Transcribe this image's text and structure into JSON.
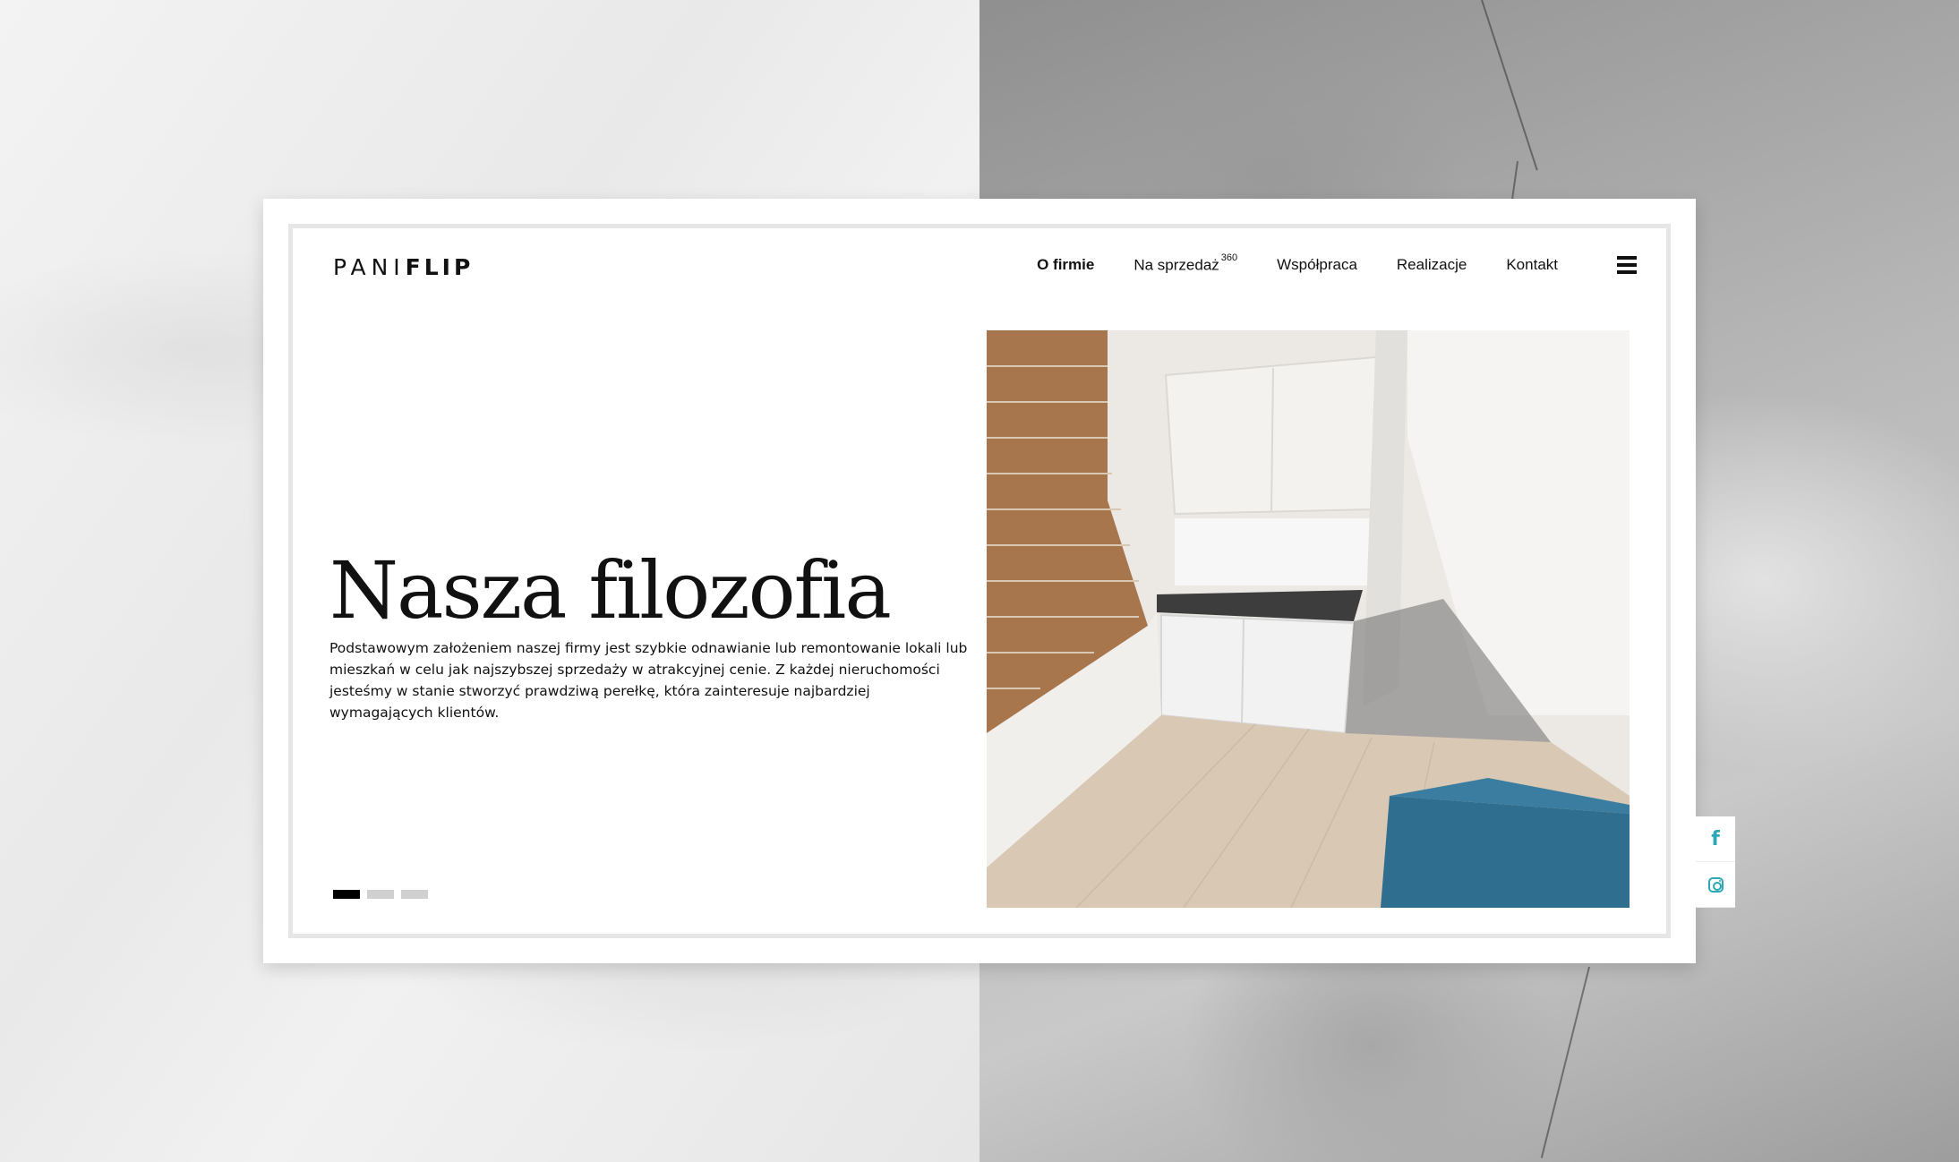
{
  "brand": {
    "logo_part1": "PANI",
    "logo_part2": "FLIP"
  },
  "nav": {
    "items": [
      {
        "label": "O firmie",
        "active": true
      },
      {
        "label": "Na sprzedaż",
        "sup": "360"
      },
      {
        "label": "Współpraca"
      },
      {
        "label": "Realizacje"
      },
      {
        "label": "Kontakt"
      }
    ],
    "menu_icon": "hamburger-icon"
  },
  "hero": {
    "title": "Nasza filozofia",
    "text": "Podstawowym założeniem naszej firmy jest szybkie odnawianie lub remontowanie lokali lub mieszkań w celu jak najszybszej sprzedaży w atrakcyjnej cenie. Z każdej nieruchomości jesteśmy w stanie stworzyć prawdziwą perełkę, która zainteresuje najbardziej wymagających klientów.",
    "slider": {
      "total": 3,
      "active_index": 0
    }
  },
  "social": {
    "facebook_icon": "facebook-icon",
    "instagram_icon": "instagram-icon",
    "accent_color": "#2ca7b6"
  }
}
